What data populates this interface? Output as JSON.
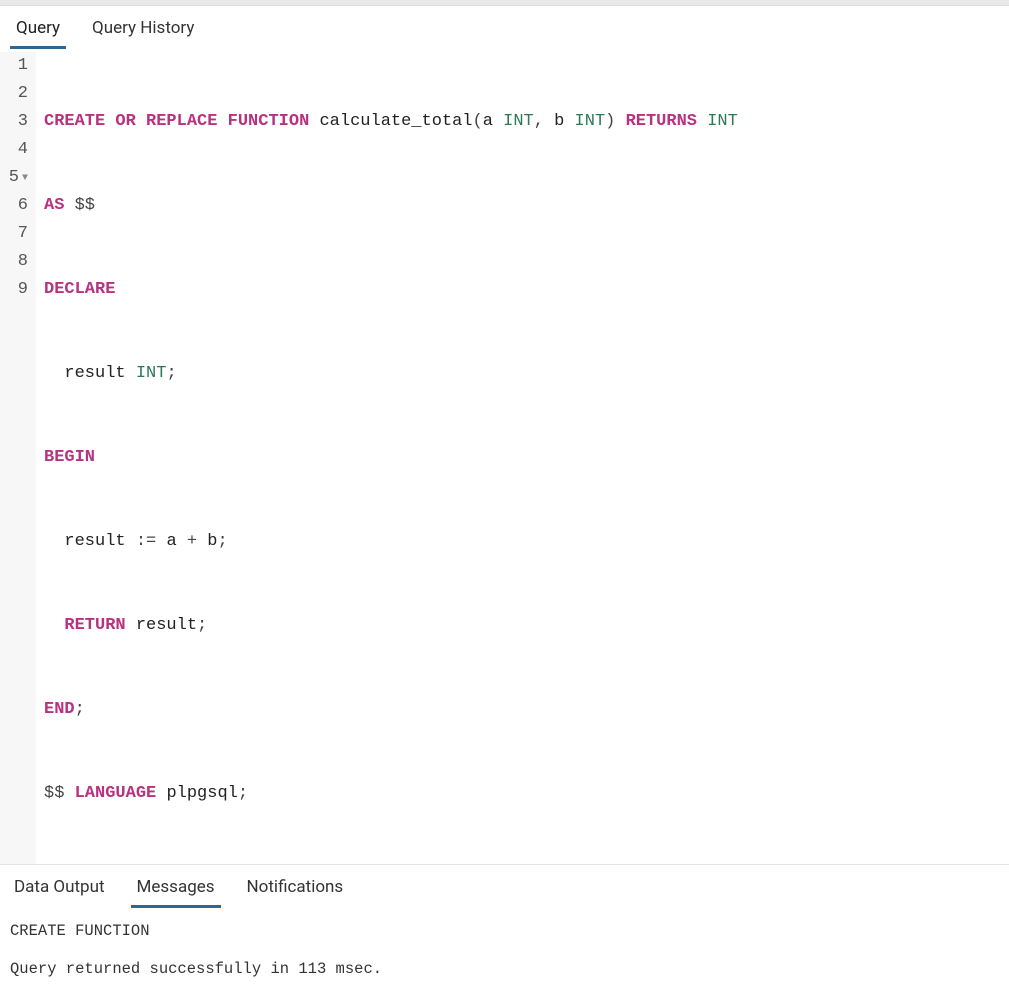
{
  "topTabs": {
    "query": "Query",
    "history": "Query History"
  },
  "editor": {
    "lines": [
      1,
      2,
      3,
      4,
      5,
      6,
      7,
      8,
      9
    ],
    "foldLine": 5,
    "tokens": {
      "l1": {
        "k1": "CREATE",
        "k2": "OR",
        "k3": "REPLACE",
        "k4": "FUNCTION",
        "fn": "calculate_total",
        "paren1": "(",
        "p1": "a",
        "t1": "INT",
        "comma": ",",
        "p2": "b",
        "t2": "INT",
        "paren2": ")",
        "k5": "RETURNS",
        "t3": "INT"
      },
      "l2": {
        "k1": "AS",
        "dd": "$$"
      },
      "l3": {
        "k1": "DECLARE"
      },
      "l4": {
        "v1": "result",
        "t1": "INT",
        "semi": ";"
      },
      "l5": {
        "k1": "BEGIN"
      },
      "l6": {
        "v1": "result",
        "asg1": ":",
        "asg2": "=",
        "a": "a",
        "plus": "+",
        "b": "b",
        "semi": ";"
      },
      "l7": {
        "k1": "RETURN",
        "v1": "result",
        "semi": ";"
      },
      "l8": {
        "k1": "END",
        "semi": ";"
      },
      "l9": {
        "dd": "$$",
        "k1": "LANGUAGE",
        "lang": "plpgsql",
        "semi": ";"
      }
    }
  },
  "resultsTabs": {
    "dataOutput": "Data Output",
    "messages": "Messages",
    "notifications": "Notifications"
  },
  "messages": {
    "line1": "CREATE FUNCTION",
    "line2": "Query returned successfully in 113 msec."
  }
}
